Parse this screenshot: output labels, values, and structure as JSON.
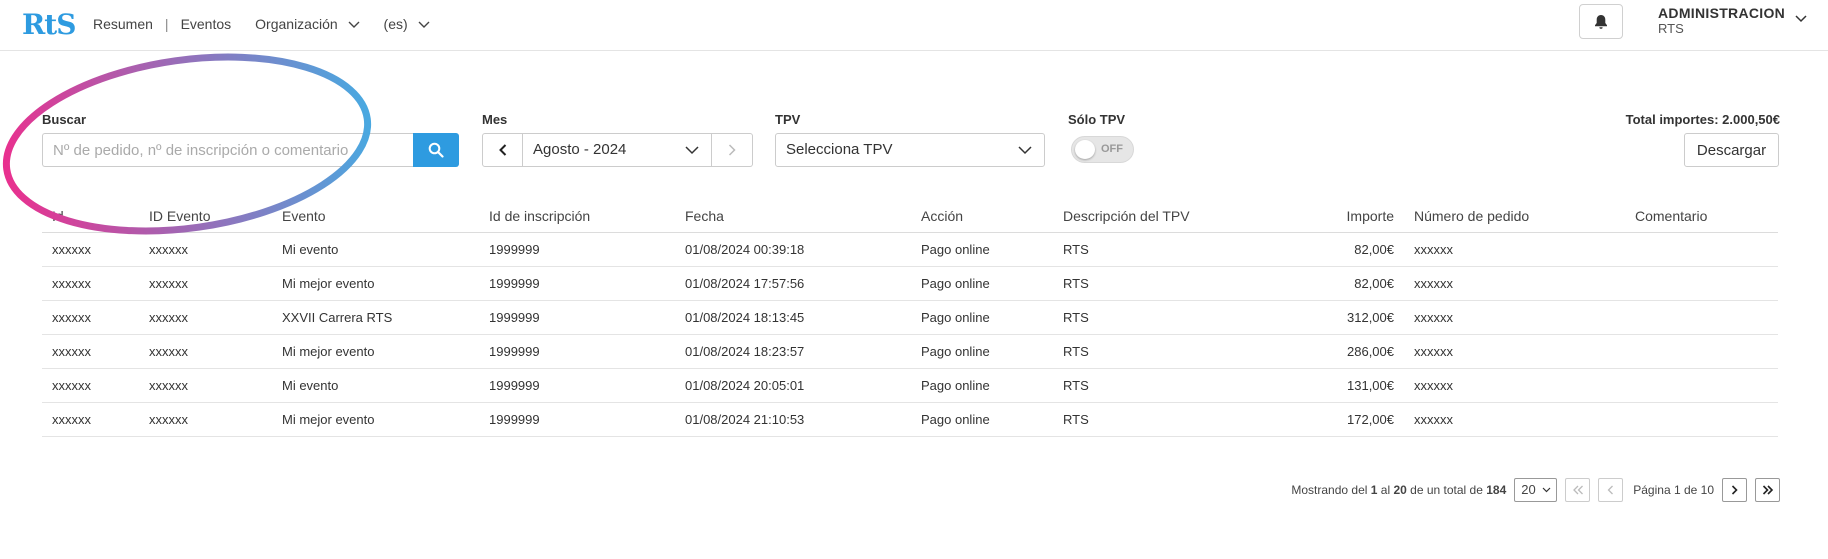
{
  "header": {
    "logo_text": "RtS",
    "nav": {
      "resumen": "Resumen",
      "separator": "|",
      "eventos": "Eventos",
      "organizacion": "Organización",
      "language": "(es)"
    },
    "user": {
      "name": "ADMINISTRACION",
      "org": "RTS"
    }
  },
  "filters": {
    "search": {
      "label": "Buscar",
      "placeholder": "Nº de pedido, nº de inscripción o comentario"
    },
    "month": {
      "label": "Mes",
      "value": "Agosto - 2024"
    },
    "tpv": {
      "label": "TPV",
      "value": "Selecciona TPV"
    },
    "solo_tpv": {
      "label": "Sólo TPV",
      "state": "OFF"
    },
    "total": "Total importes: 2.000,50€",
    "download_label": "Descargar"
  },
  "table": {
    "headers": [
      "Id",
      "ID Evento",
      "Evento",
      "Id de inscripción",
      "Fecha",
      "Acción",
      "Descripción del TPV",
      "Importe",
      "Número de pedido",
      "Comentario"
    ],
    "rows": [
      [
        "xxxxxx",
        "xxxxxx",
        "Mi evento",
        "1999999",
        "01/08/2024 00:39:18",
        "Pago online",
        "RTS",
        "82,00€",
        "xxxxxx",
        ""
      ],
      [
        "xxxxxx",
        "xxxxxx",
        "Mi mejor evento",
        "1999999",
        "01/08/2024 17:57:56",
        "Pago online",
        "RTS",
        "82,00€",
        "xxxxxx",
        ""
      ],
      [
        "xxxxxx",
        "xxxxxx",
        "XXVII Carrera RTS",
        "1999999",
        "01/08/2024 18:13:45",
        "Pago online",
        "RTS",
        "312,00€",
        "xxxxxx",
        ""
      ],
      [
        "xxxxxx",
        "xxxxxx",
        "Mi mejor evento",
        "1999999",
        "01/08/2024 18:23:57",
        "Pago online",
        "RTS",
        "286,00€",
        "xxxxxx",
        ""
      ],
      [
        "xxxxxx",
        "xxxxxx",
        "Mi evento",
        "1999999",
        "01/08/2024 20:05:01",
        "Pago online",
        "RTS",
        "131,00€",
        "xxxxxx",
        ""
      ],
      [
        "xxxxxx",
        "xxxxxx",
        "Mi mejor evento",
        "1999999",
        "01/08/2024 21:10:53",
        "Pago online",
        "RTS",
        "172,00€",
        "xxxxxx",
        ""
      ]
    ]
  },
  "pagination": {
    "prefix": "Mostrando del ",
    "from": "1",
    "mid1": " al ",
    "to": "20",
    "mid2": " de un total de ",
    "total": "184",
    "per_page": "20",
    "page_label": "Página 1 de 10"
  },
  "colors": {
    "accent": "#2e9be0",
    "annotation_start": "#e8318f",
    "annotation_end": "#4aa8e0"
  }
}
